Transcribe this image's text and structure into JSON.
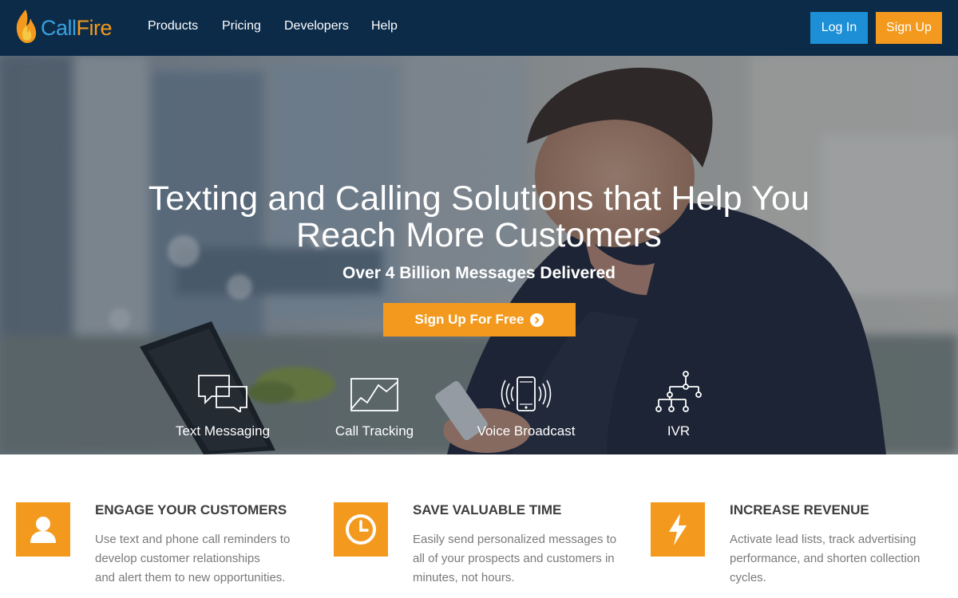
{
  "brand": {
    "name_part1": "Call",
    "name_part2": "Fire",
    "logo_icon": "flame-icon",
    "colors": {
      "call": "#3aa0dd",
      "fire": "#f39a1e"
    }
  },
  "nav": {
    "links": [
      "Products",
      "Pricing",
      "Developers",
      "Help"
    ],
    "login_label": "Log In",
    "signup_label": "Sign Up",
    "background": "#0b2b49"
  },
  "hero": {
    "title_line1": "Texting and Calling Solutions that Help You",
    "title_line2": "Reach More Customers",
    "subtitle": "Over 4 Billion Messages Delivered",
    "cta_label": "Sign Up For Free",
    "cta_icon": "arrow-circle-right-icon",
    "features": [
      {
        "label": "Text Messaging",
        "icon": "chat-bubbles-icon"
      },
      {
        "label": "Call Tracking",
        "icon": "line-chart-icon"
      },
      {
        "label": "Voice Broadcast",
        "icon": "phone-broadcast-icon"
      },
      {
        "label": "IVR",
        "icon": "tree-network-icon"
      }
    ]
  },
  "benefits": [
    {
      "title": "ENGAGE YOUR CUSTOMERS",
      "lines": [
        "Use text and phone call reminders to",
        "develop customer relationships",
        "and alert them to new opportunities."
      ],
      "icon": "user-icon"
    },
    {
      "title": "SAVE VALUABLE TIME",
      "lines": [
        "Easily send personalized messages to",
        "all of your prospects and customers in",
        "minutes, not hours."
      ],
      "icon": "clock-icon"
    },
    {
      "title": "INCREASE REVENUE",
      "lines": [
        "Activate lead lists, track advertising",
        "performance, and shorten collection",
        "cycles."
      ],
      "icon": "lightning-icon"
    }
  ],
  "accent_color": "#f39a1e"
}
